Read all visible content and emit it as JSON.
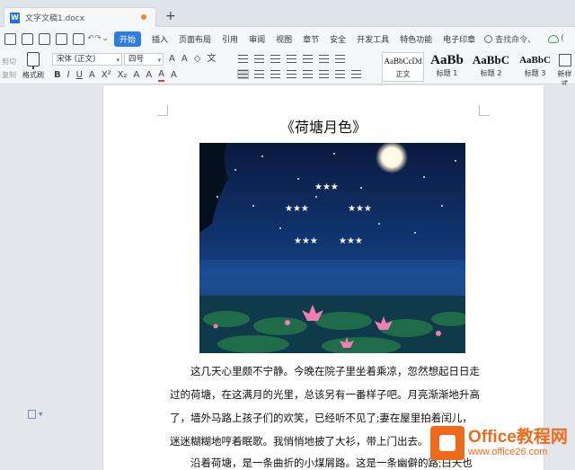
{
  "tabbar": {
    "file_name": "文字文稿1.docx",
    "doc_icon_letter": "W",
    "new_tab": "+"
  },
  "menu": {
    "items": [
      "开始",
      "插入",
      "页面布局",
      "引用",
      "审阅",
      "视图",
      "章节",
      "安全",
      "开发工具",
      "特色功能",
      "电子印章"
    ],
    "active_index": 0,
    "search_label": "查找命令、",
    "cloud_label": "("
  },
  "ribbon": {
    "cut_label": "剪切",
    "copy_label": "复制",
    "painter_label": "格式刷",
    "font_name": "宋体 (正文)",
    "font_size": "四号",
    "styles": [
      {
        "preview": "AaBbCcDd",
        "name": "正文"
      },
      {
        "preview": "AaBb",
        "name": "标题 1"
      },
      {
        "preview": "AaBbC",
        "name": "标题 2"
      },
      {
        "preview": "AaBbC",
        "name": "标题 3"
      }
    ],
    "new_style_label": "新样式"
  },
  "document": {
    "title": "《荷塘月色》",
    "paragraph_lines": [
      "这几天心里颇不宁静。今晚在院子里坐着乘凉，忽然想起日日走",
      "过的荷塘，在这满月的光里，总该另有一番样子吧。月亮渐渐地升高",
      "了，墙外马路上孩子们的欢笑，已经听不见了;妻在屋里拍着闰儿，",
      "迷迷糊糊地哼着眠歌。我悄悄地披了大衫，带上门出去。",
      "沿着荷塘，是一条曲折的小煤屑路。这是一条幽僻的路;白天也"
    ]
  },
  "watermark": {
    "brand": "Office教程网",
    "url": "www.office26.com"
  },
  "colors": {
    "accent": "#2f7ce0",
    "watermark": "#ee6b1b",
    "modified_dot": "#f08a24"
  }
}
